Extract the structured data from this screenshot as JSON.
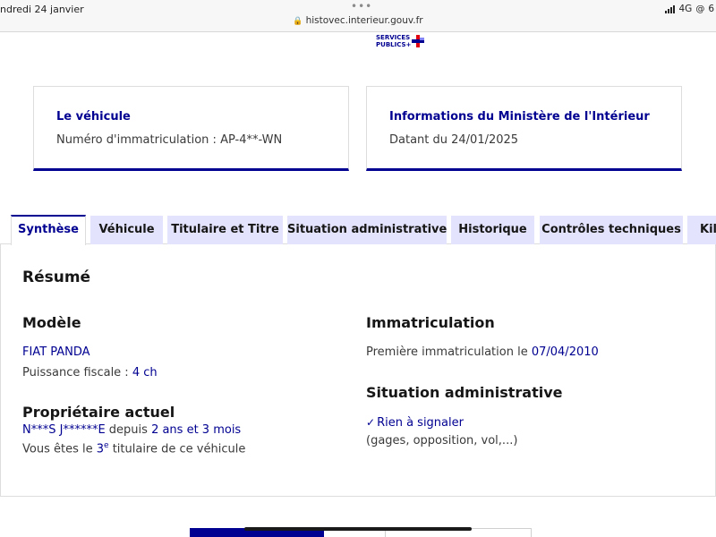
{
  "statusbar": {
    "date": "ndredi 24 janvier",
    "dots": "•••",
    "url": "histovec.interieur.gouv.fr",
    "network": "4G",
    "battery_partial": "6"
  },
  "logo": {
    "line1": "SERVICES",
    "line2": "PUBLICS+"
  },
  "cards": [
    {
      "title": "Le véhicule",
      "text": "Numéro d'immatriculation : AP-4**-WN"
    },
    {
      "title": "Informations du Ministère de l'Intérieur",
      "text": "Datant du 24/01/2025"
    }
  ],
  "tabs": [
    {
      "label": "Synthèse",
      "active": true
    },
    {
      "label": "Véhicule"
    },
    {
      "label": "Titulaire et Titre"
    },
    {
      "label": "Situation administrative"
    },
    {
      "label": "Historique"
    },
    {
      "label": "Contrôles techniques"
    },
    {
      "label": "Kilo"
    }
  ],
  "summary": {
    "title": "Résumé",
    "model": {
      "heading": "Modèle",
      "name": "FIAT PANDA",
      "power_label": "Puissance fiscale : ",
      "power_value": "4 ch"
    },
    "owner": {
      "heading": "Propriétaire actuel",
      "name": "N***S J******E",
      "since_label": " depuis ",
      "duration": "2 ans et 3 mois",
      "rank_prefix": "Vous êtes le ",
      "rank_number": "3",
      "rank_sup": "e",
      "rank_suffix": " titulaire de ce véhicule"
    },
    "registration": {
      "heading": "Immatriculation",
      "label": "Première immatriculation le ",
      "date": "07/04/2010"
    },
    "admin": {
      "heading": "Situation administrative",
      "status": "Rien à signaler",
      "detail": "(gages, opposition, vol,...)"
    }
  },
  "colors": {
    "primary": "#000091",
    "tab_bg": "#e3e3fd",
    "text": "#3a3a3a",
    "heading": "#161616"
  }
}
